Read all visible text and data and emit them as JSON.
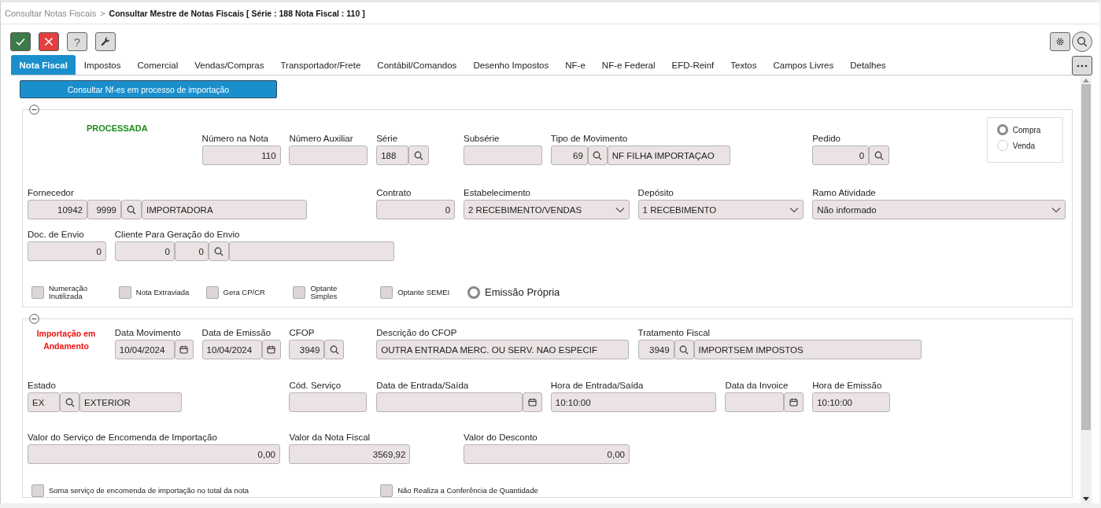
{
  "breadcrumb": {
    "parent": "Consultar Notas Fiscais",
    "separator": ">",
    "current": "Consultar Mestre de Notas Fiscais [ Série : 188 Nota Fiscal : 110 ]"
  },
  "toolbar": [
    {
      "kind": "confirm"
    },
    {
      "kind": "cancel"
    },
    {
      "kind": "help",
      "label": "?"
    },
    {
      "kind": "tools"
    }
  ],
  "tabs": [
    {
      "label": "Nota Fiscal",
      "selected": true
    },
    {
      "label": "Impostos",
      "selected": false
    },
    {
      "label": "Comercial",
      "selected": false
    },
    {
      "label": "Vendas/Compras",
      "selected": false
    },
    {
      "label": "Transportador/Frete",
      "selected": false
    },
    {
      "label": "Contábil/Comandos",
      "selected": false
    },
    {
      "label": "Desenho Impostos",
      "selected": false
    },
    {
      "label": "NF-e",
      "selected": false
    },
    {
      "label": "NF-e Federal",
      "selected": false
    },
    {
      "label": "EFD-Reinf",
      "selected": false
    },
    {
      "label": "Textos",
      "selected": false
    },
    {
      "label": "Campos Livres",
      "selected": false
    },
    {
      "label": "Detalhes",
      "selected": false
    }
  ],
  "import_button": "Consultar Nf-es em processo de importação",
  "sections": [
    {
      "expanded": true,
      "status": {
        "text": "PROCESSADA",
        "color": "#1e8c1e"
      },
      "rows": [
        {
          "fields": [
            {
              "label": "Número na Nota",
              "parts": [
                {
                  "kind": "number",
                  "value": "110"
                }
              ]
            },
            {
              "label": "Número Auxiliar",
              "parts": [
                {
                  "kind": "number"
                }
              ]
            },
            {
              "label": "Série",
              "parts": [
                {
                  "kind": "text",
                  "value": "188"
                },
                {
                  "kind": "search"
                }
              ]
            },
            {
              "label": "Subsérie",
              "parts": [
                {
                  "kind": "text"
                }
              ]
            },
            {
              "label": "Tipo de Movimento",
              "parts": [
                {
                  "kind": "number",
                  "value": "69"
                },
                {
                  "kind": "search"
                },
                {
                  "kind": "text",
                  "value": "NF FILHA IMPORTAÇAO"
                }
              ]
            },
            {
              "label": "Pedido",
              "parts": [
                {
                  "kind": "number",
                  "value": "0"
                },
                {
                  "kind": "search"
                }
              ]
            }
          ]
        },
        {
          "fields": [
            {
              "label": "Fornecedor",
              "parts": [
                {
                  "kind": "number",
                  "value": "10942"
                },
                {
                  "kind": "number",
                  "value": "9999"
                },
                {
                  "kind": "search"
                },
                {
                  "kind": "text",
                  "value": "IMPORTADORA"
                }
              ]
            },
            {
              "label": "Contrato",
              "parts": [
                {
                  "kind": "number",
                  "value": "0"
                }
              ]
            },
            {
              "label": "Estabelecimento",
              "parts": [
                {
                  "kind": "select",
                  "value": "2 RECEBIMENTO/VENDAS"
                }
              ]
            },
            {
              "label": "Depósito",
              "parts": [
                {
                  "kind": "select",
                  "value": "1 RECEBIMENTO"
                }
              ]
            },
            {
              "label": "Ramo Atividade",
              "parts": [
                {
                  "kind": "select",
                  "value": "Não informado"
                }
              ]
            }
          ]
        },
        {
          "fields": [
            {
              "label": "Doc. de Envio",
              "parts": [
                {
                  "kind": "number",
                  "value": "0"
                }
              ]
            },
            {
              "label": "Cliente Para Geração do Envio",
              "parts": [
                {
                  "kind": "number",
                  "value": "0"
                },
                {
                  "kind": "number",
                  "value": "0"
                },
                {
                  "kind": "search"
                },
                {
                  "kind": "text"
                }
              ]
            }
          ]
        }
      ],
      "options": [
        {
          "kind": "checkbox",
          "label": "Numeração Inutilizada",
          "checked": false
        },
        {
          "kind": "checkbox",
          "label": "Nota Extraviada",
          "checked": false
        },
        {
          "kind": "checkbox",
          "label": "Gera CP/CR",
          "checked": false
        },
        {
          "kind": "checkbox",
          "label": "Optante Simples",
          "checked": false
        },
        {
          "kind": "checkbox",
          "label": "Optante SEMEI",
          "checked": false
        },
        {
          "kind": "radio",
          "label": "Emissão Própria",
          "checked": true
        }
      ],
      "radio_group": [
        {
          "label": "Compra",
          "selected": true
        },
        {
          "label": "Venda",
          "selected": false
        }
      ]
    },
    {
      "expanded": true,
      "status": {
        "text": "Importação em Andamento",
        "color": "#ee1111"
      },
      "rows": [
        {
          "fields": [
            {
              "label": "Data Movimento",
              "parts": [
                {
                  "kind": "text",
                  "value": "10/04/2024"
                },
                {
                  "kind": "calendar"
                }
              ]
            },
            {
              "label": "Data de Emissão",
              "parts": [
                {
                  "kind": "text",
                  "value": "10/04/2024"
                },
                {
                  "kind": "calendar"
                }
              ]
            },
            {
              "label": "CFOP",
              "parts": [
                {
                  "kind": "number",
                  "value": "3949"
                },
                {
                  "kind": "search"
                }
              ]
            },
            {
              "label": "Descrição do CFOP",
              "parts": [
                {
                  "kind": "text",
                  "value": "OUTRA ENTRADA MERC. OU SERV. NAO ESPECIF"
                }
              ]
            },
            {
              "label": "Tratamento Fiscal",
              "parts": [
                {
                  "kind": "number",
                  "value": "3949"
                },
                {
                  "kind": "search"
                },
                {
                  "kind": "text",
                  "value": "IMPORTSEM IMPOSTOS"
                }
              ]
            }
          ]
        },
        {
          "fields": [
            {
              "label": "Estado",
              "parts": [
                {
                  "kind": "text",
                  "value": "EX"
                },
                {
                  "kind": "search"
                },
                {
                  "kind": "text",
                  "value": "EXTERIOR"
                }
              ]
            },
            {
              "label": "Cód. Serviço",
              "parts": [
                {
                  "kind": "text"
                }
              ]
            },
            {
              "label": "Data de Entrada/Saída",
              "parts": [
                {
                  "kind": "text"
                },
                {
                  "kind": "calendar"
                }
              ]
            },
            {
              "label": "Hora de Entrada/Saída",
              "parts": [
                {
                  "kind": "text",
                  "value": "10:10:00"
                }
              ]
            },
            {
              "label": "Data da Invoice",
              "parts": [
                {
                  "kind": "text"
                },
                {
                  "kind": "calendar"
                }
              ]
            },
            {
              "label": "Hora de Emissão",
              "parts": [
                {
                  "kind": "text",
                  "value": "10:10:00"
                }
              ]
            }
          ]
        },
        {
          "fields": [
            {
              "label": "Valor do Serviço de Encomenda de Importação",
              "parts": [
                {
                  "kind": "number",
                  "value": "0,00"
                }
              ]
            },
            {
              "label": "Valor da Nota Fiscal",
              "parts": [
                {
                  "kind": "number",
                  "value": "3569,92"
                }
              ]
            },
            {
              "label": "Valor do Desconto",
              "parts": [
                {
                  "kind": "number",
                  "value": "0,00"
                }
              ]
            }
          ]
        }
      ],
      "options": [
        {
          "kind": "checkbox",
          "label": "Soma serviço de encomenda de importação no total da nota",
          "checked": false
        },
        {
          "kind": "checkbox",
          "label": "Não Realiza a Conferência de Quantidade",
          "checked": false
        }
      ]
    }
  ]
}
